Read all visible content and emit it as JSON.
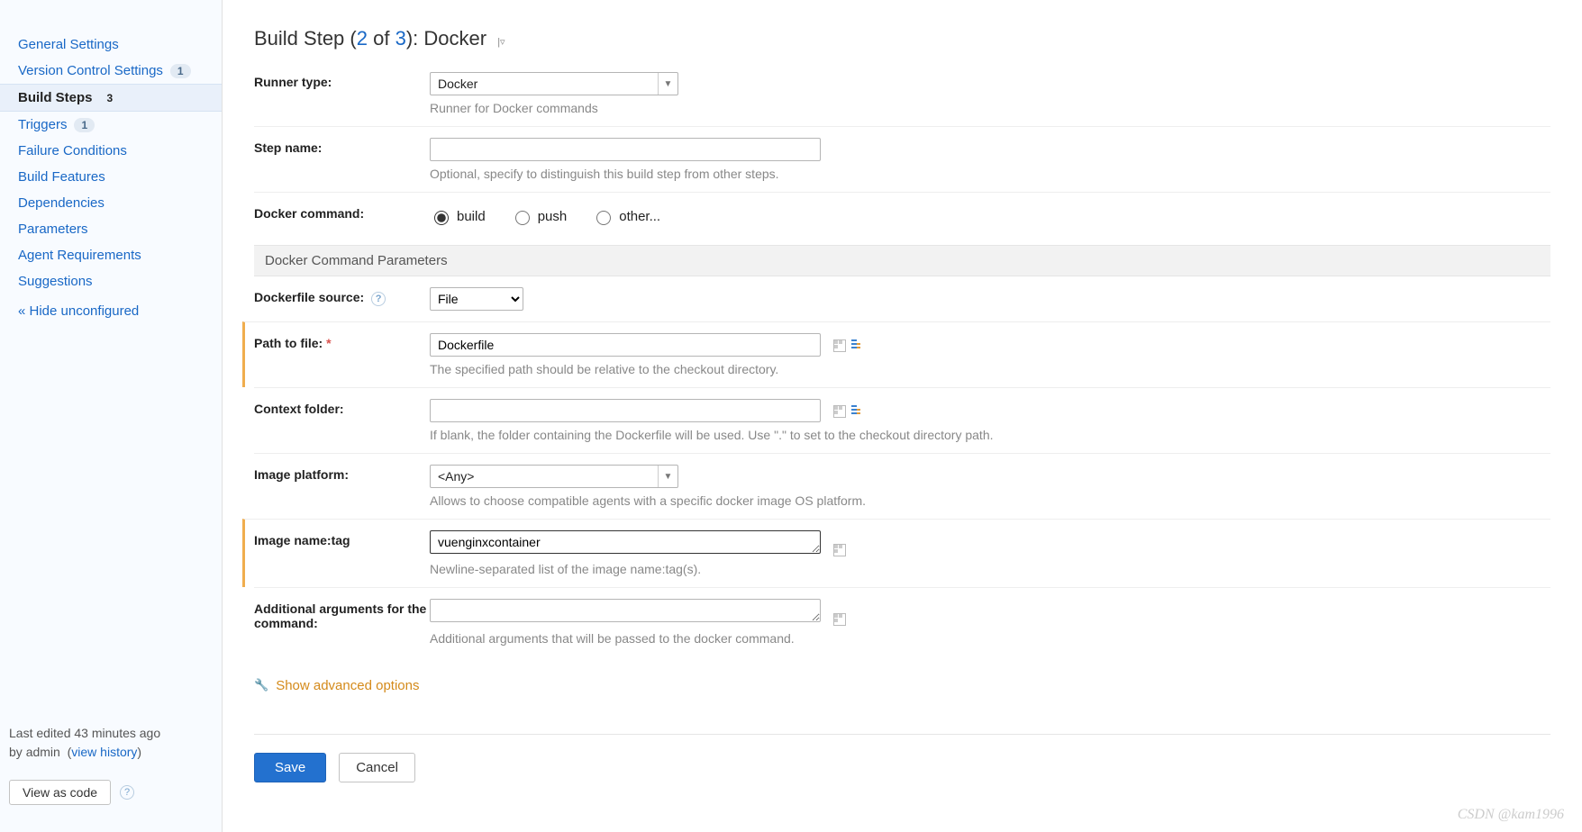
{
  "sidebar": {
    "items": [
      {
        "label": "General Settings"
      },
      {
        "label": "Version Control Settings",
        "badge": "1"
      },
      {
        "label": "Build Steps",
        "badge": "3",
        "active": true
      },
      {
        "label": "Triggers",
        "badge": "1"
      },
      {
        "label": "Failure Conditions"
      },
      {
        "label": "Build Features"
      },
      {
        "label": "Dependencies"
      },
      {
        "label": "Parameters"
      },
      {
        "label": "Agent Requirements"
      },
      {
        "label": "Suggestions"
      }
    ],
    "hide_link": "« Hide unconfigured",
    "edited_prefix": "Last edited ",
    "edited_time": "43 minutes ago",
    "edited_by_prefix": "by ",
    "edited_by": "admin",
    "history_link": "view history",
    "view_code": "View as code"
  },
  "title": {
    "prefix": "Build Step (",
    "cur": "2",
    "of": " of ",
    "total": "3",
    "suffix": "): ",
    "name": "Docker"
  },
  "form": {
    "runner_type_label": "Runner type:",
    "runner_type_value": "Docker",
    "runner_type_hint": "Runner for Docker commands",
    "step_name_label": "Step name:",
    "step_name_value": "",
    "step_name_hint": "Optional, specify to distinguish this build step from other steps.",
    "docker_cmd_label": "Docker command:",
    "docker_cmd_options": {
      "build": "build",
      "push": "push",
      "other": "other..."
    },
    "docker_cmd_selected": "build",
    "section_header": "Docker Command Parameters",
    "dockerfile_src_label": "Dockerfile source:",
    "dockerfile_src_value": "File",
    "path_label": "Path to file:",
    "path_value": "Dockerfile",
    "path_hint": "The specified path should be relative to the checkout directory.",
    "context_label": "Context folder:",
    "context_value": "",
    "context_hint": "If blank, the folder containing the Dockerfile will be used. Use \".\" to set to the checkout directory path.",
    "platform_label": "Image platform:",
    "platform_value": "<Any>",
    "platform_hint": "Allows to choose compatible agents with a specific docker image OS platform.",
    "image_label": "Image name:tag",
    "image_value": "vuenginxcontainer",
    "image_hint": "Newline-separated list of the image name:tag(s).",
    "args_label": "Additional arguments for the command:",
    "args_value": "",
    "args_hint": "Additional arguments that will be passed to the docker command.",
    "advanced_link": "Show advanced options",
    "save": "Save",
    "cancel": "Cancel"
  },
  "watermark": "CSDN @kam1996"
}
